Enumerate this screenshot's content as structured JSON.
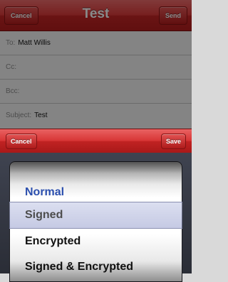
{
  "compose": {
    "title": "Test",
    "cancel_label": "Cancel",
    "send_label": "Send",
    "fields": [
      {
        "label": "To:",
        "value": "Matt Willis"
      },
      {
        "label": "Cc:",
        "value": ""
      },
      {
        "label": "Bcc:",
        "value": ""
      },
      {
        "label": "Subject:",
        "value": "Test"
      }
    ]
  },
  "picker": {
    "cancel_label": "Cancel",
    "save_label": "Save",
    "options": [
      "Normal",
      "Signed",
      "Encrypted",
      "Signed & Encrypted"
    ],
    "selected": "Normal"
  },
  "colors": {
    "accent": "#d32f2f",
    "selected_text": "#2b4fae"
  }
}
